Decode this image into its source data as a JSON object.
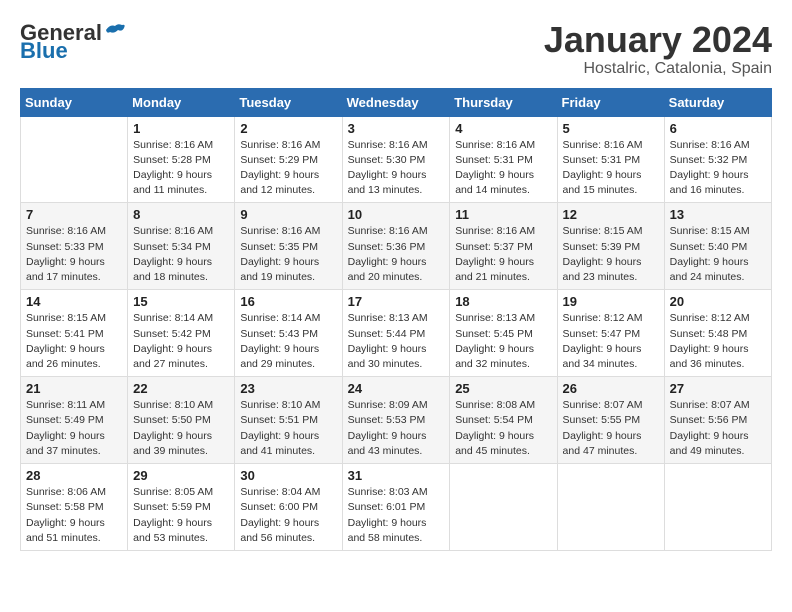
{
  "logo": {
    "general": "General",
    "blue": "Blue"
  },
  "header": {
    "title": "January 2024",
    "subtitle": "Hostalric, Catalonia, Spain"
  },
  "weekdays": [
    "Sunday",
    "Monday",
    "Tuesday",
    "Wednesday",
    "Thursday",
    "Friday",
    "Saturday"
  ],
  "weeks": [
    [
      {
        "day": "",
        "info": ""
      },
      {
        "day": "1",
        "info": "Sunrise: 8:16 AM\nSunset: 5:28 PM\nDaylight: 9 hours\nand 11 minutes."
      },
      {
        "day": "2",
        "info": "Sunrise: 8:16 AM\nSunset: 5:29 PM\nDaylight: 9 hours\nand 12 minutes."
      },
      {
        "day": "3",
        "info": "Sunrise: 8:16 AM\nSunset: 5:30 PM\nDaylight: 9 hours\nand 13 minutes."
      },
      {
        "day": "4",
        "info": "Sunrise: 8:16 AM\nSunset: 5:31 PM\nDaylight: 9 hours\nand 14 minutes."
      },
      {
        "day": "5",
        "info": "Sunrise: 8:16 AM\nSunset: 5:31 PM\nDaylight: 9 hours\nand 15 minutes."
      },
      {
        "day": "6",
        "info": "Sunrise: 8:16 AM\nSunset: 5:32 PM\nDaylight: 9 hours\nand 16 minutes."
      }
    ],
    [
      {
        "day": "7",
        "info": "Sunrise: 8:16 AM\nSunset: 5:33 PM\nDaylight: 9 hours\nand 17 minutes."
      },
      {
        "day": "8",
        "info": "Sunrise: 8:16 AM\nSunset: 5:34 PM\nDaylight: 9 hours\nand 18 minutes."
      },
      {
        "day": "9",
        "info": "Sunrise: 8:16 AM\nSunset: 5:35 PM\nDaylight: 9 hours\nand 19 minutes."
      },
      {
        "day": "10",
        "info": "Sunrise: 8:16 AM\nSunset: 5:36 PM\nDaylight: 9 hours\nand 20 minutes."
      },
      {
        "day": "11",
        "info": "Sunrise: 8:16 AM\nSunset: 5:37 PM\nDaylight: 9 hours\nand 21 minutes."
      },
      {
        "day": "12",
        "info": "Sunrise: 8:15 AM\nSunset: 5:39 PM\nDaylight: 9 hours\nand 23 minutes."
      },
      {
        "day": "13",
        "info": "Sunrise: 8:15 AM\nSunset: 5:40 PM\nDaylight: 9 hours\nand 24 minutes."
      }
    ],
    [
      {
        "day": "14",
        "info": "Sunrise: 8:15 AM\nSunset: 5:41 PM\nDaylight: 9 hours\nand 26 minutes."
      },
      {
        "day": "15",
        "info": "Sunrise: 8:14 AM\nSunset: 5:42 PM\nDaylight: 9 hours\nand 27 minutes."
      },
      {
        "day": "16",
        "info": "Sunrise: 8:14 AM\nSunset: 5:43 PM\nDaylight: 9 hours\nand 29 minutes."
      },
      {
        "day": "17",
        "info": "Sunrise: 8:13 AM\nSunset: 5:44 PM\nDaylight: 9 hours\nand 30 minutes."
      },
      {
        "day": "18",
        "info": "Sunrise: 8:13 AM\nSunset: 5:45 PM\nDaylight: 9 hours\nand 32 minutes."
      },
      {
        "day": "19",
        "info": "Sunrise: 8:12 AM\nSunset: 5:47 PM\nDaylight: 9 hours\nand 34 minutes."
      },
      {
        "day": "20",
        "info": "Sunrise: 8:12 AM\nSunset: 5:48 PM\nDaylight: 9 hours\nand 36 minutes."
      }
    ],
    [
      {
        "day": "21",
        "info": "Sunrise: 8:11 AM\nSunset: 5:49 PM\nDaylight: 9 hours\nand 37 minutes."
      },
      {
        "day": "22",
        "info": "Sunrise: 8:10 AM\nSunset: 5:50 PM\nDaylight: 9 hours\nand 39 minutes."
      },
      {
        "day": "23",
        "info": "Sunrise: 8:10 AM\nSunset: 5:51 PM\nDaylight: 9 hours\nand 41 minutes."
      },
      {
        "day": "24",
        "info": "Sunrise: 8:09 AM\nSunset: 5:53 PM\nDaylight: 9 hours\nand 43 minutes."
      },
      {
        "day": "25",
        "info": "Sunrise: 8:08 AM\nSunset: 5:54 PM\nDaylight: 9 hours\nand 45 minutes."
      },
      {
        "day": "26",
        "info": "Sunrise: 8:07 AM\nSunset: 5:55 PM\nDaylight: 9 hours\nand 47 minutes."
      },
      {
        "day": "27",
        "info": "Sunrise: 8:07 AM\nSunset: 5:56 PM\nDaylight: 9 hours\nand 49 minutes."
      }
    ],
    [
      {
        "day": "28",
        "info": "Sunrise: 8:06 AM\nSunset: 5:58 PM\nDaylight: 9 hours\nand 51 minutes."
      },
      {
        "day": "29",
        "info": "Sunrise: 8:05 AM\nSunset: 5:59 PM\nDaylight: 9 hours\nand 53 minutes."
      },
      {
        "day": "30",
        "info": "Sunrise: 8:04 AM\nSunset: 6:00 PM\nDaylight: 9 hours\nand 56 minutes."
      },
      {
        "day": "31",
        "info": "Sunrise: 8:03 AM\nSunset: 6:01 PM\nDaylight: 9 hours\nand 58 minutes."
      },
      {
        "day": "",
        "info": ""
      },
      {
        "day": "",
        "info": ""
      },
      {
        "day": "",
        "info": ""
      }
    ]
  ]
}
